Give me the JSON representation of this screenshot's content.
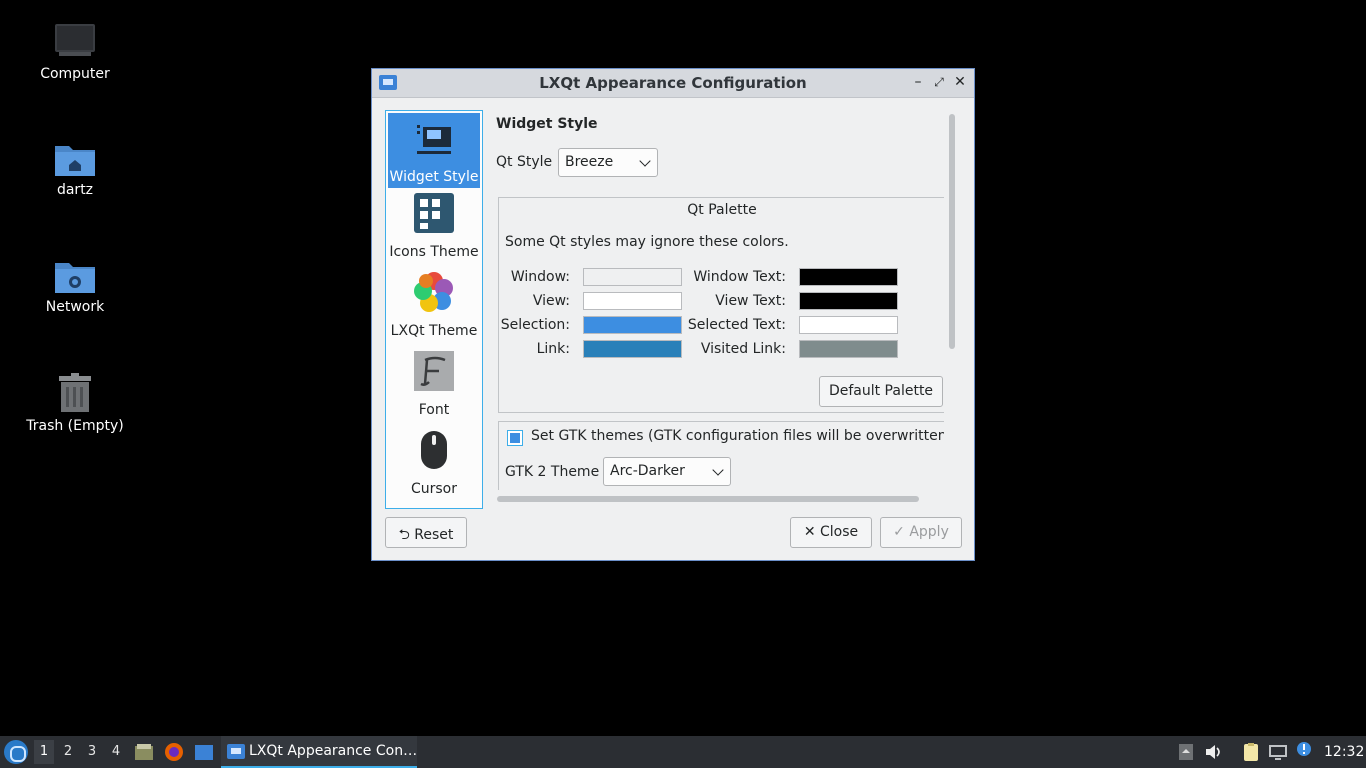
{
  "desktop": {
    "icons": [
      {
        "label": "Computer",
        "icon": "computer-icon"
      },
      {
        "label": "dartz",
        "icon": "home-folder-icon"
      },
      {
        "label": "Network",
        "icon": "network-folder-icon"
      },
      {
        "label": "Trash (Empty)",
        "icon": "trash-icon"
      }
    ]
  },
  "window": {
    "title": "LXQt Appearance Configuration",
    "sidebar": [
      {
        "label": "Widget Style",
        "icon": "widget-style-icon",
        "active": true
      },
      {
        "label": "Icons Theme",
        "icon": "icons-theme-icon"
      },
      {
        "label": "LXQt Theme",
        "icon": "lxqt-theme-icon"
      },
      {
        "label": "Font",
        "icon": "font-icon"
      },
      {
        "label": "Cursor",
        "icon": "cursor-icon"
      }
    ],
    "widget_style_heading": "Widget Style",
    "qt_style_label": "Qt Style",
    "qt_style_value": "Breeze",
    "palette": {
      "title": "Qt Palette",
      "note": "Some Qt styles may ignore these colors.",
      "rows": [
        {
          "left_label": "Window:",
          "left_color": "#eff0f1",
          "right_label": "Window Text:",
          "right_color": "#000000"
        },
        {
          "left_label": "View:",
          "left_color": "#ffffff",
          "right_label": "View Text:",
          "right_color": "#000000"
        },
        {
          "left_label": "Selection:",
          "left_color": "#3d8ee1",
          "right_label": "Selected Text:",
          "right_color": "#ffffff"
        },
        {
          "left_label": "Link:",
          "left_color": "#2980b9",
          "right_label": "Visited Link:",
          "right_color": "#7f8c8d"
        }
      ],
      "default_button": "Default Palette"
    },
    "gtk": {
      "checkbox_label": "Set GTK themes (GTK configuration files will be overwritten!)",
      "checked": true,
      "gtk2_label": "GTK 2 Theme",
      "gtk2_value": "Arc-Darker"
    },
    "buttons": {
      "reset": "Reset",
      "close": "Close",
      "apply": "Apply"
    }
  },
  "taskbar": {
    "workspaces": [
      "1",
      "2",
      "3",
      "4"
    ],
    "active_workspace": "1",
    "task_label": "LXQt Appearance Con…",
    "clock": "12:32"
  }
}
